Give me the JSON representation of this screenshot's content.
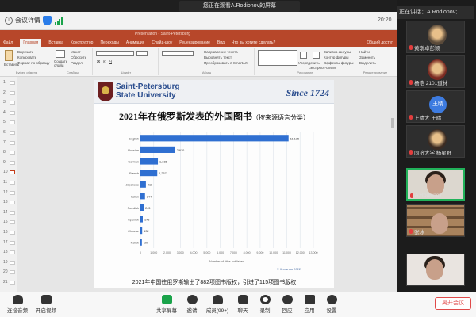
{
  "share_notice": "您正在观看A.Rodionov的屏幕",
  "meeting_top": {
    "info_label": "会议详情",
    "clock": "20:20"
  },
  "ppt": {
    "doc_title": "Presentation - Saint-Petersburg",
    "tabs": [
      "Файл",
      "Главная",
      "Вставка",
      "Конструктор",
      "Переходы",
      "Анимация",
      "Слайд-шоу",
      "Рецензирование",
      "Вид",
      "Что вы хотите сделать?"
    ],
    "share": "Общий доступ",
    "ribbon": {
      "paste": "Вставить",
      "cut": "Вырезать",
      "copy": "Копировать",
      "format": "Формат по образцу",
      "clipboard_group": "Буфер обмена",
      "new_slide": "Создать слайд",
      "layout": "Макет",
      "reset": "Сбросить",
      "section": "Раздел",
      "slides_group": "Слайды",
      "font_group": "Шрифт",
      "paragraph_group": "Абзац",
      "text_direction": "Направление текста",
      "align_text": "Выровнять текст",
      "convert_smartart": "Преобразовать в SmartArt",
      "drawing_group": "Рисование",
      "arrange": "Упорядочить",
      "quick_styles": "Экспресс-стили",
      "shape_fill": "Заливка фигуры",
      "shape_outline": "Контур фигуры",
      "shape_effects": "Эффекты фигуры",
      "find": "Найти",
      "replace": "Заменить",
      "select": "Выделить",
      "editing_group": "Редактирование"
    }
  },
  "slide": {
    "uni_line1": "Saint-Petersburg",
    "uni_line2": "State University",
    "since": "Since 1724",
    "title": "2021年在俄罗斯发表的外国图书",
    "title_sub": "（按来源语言分类）",
    "caption": "2021年中国往俄罗斯输出了882项图书版权，引进了115项图书版权",
    "footer": "© Книжная 2022"
  },
  "chart_data": {
    "type": "bar",
    "orientation": "horizontal",
    "categories": [
      "English",
      "Russian",
      "German",
      "French",
      "Japanese",
      "Italian",
      "Swedish",
      "Spanish",
      "Chinese",
      "Polish"
    ],
    "values": [
      11135,
      2610,
      1315,
      1267,
      411,
      344,
      243,
      178,
      132,
      109
    ],
    "value_labels": [
      "11,135",
      "2,610",
      "1,315",
      "1,267",
      "411",
      "344",
      "243",
      "178",
      "132",
      "109"
    ],
    "xlabel": "Number of titles published",
    "xlim": [
      0,
      13000
    ],
    "xticks": [
      "0",
      "1,000",
      "2,000",
      "3,000",
      "4,000",
      "5,000",
      "6,000",
      "7,000",
      "8,000",
      "9,000",
      "10,000",
      "11,000",
      "12,000",
      "13,000"
    ],
    "bar_color": "#2f6fd1",
    "grid": true
  },
  "thumbs": [
    1,
    2,
    3,
    4,
    5,
    6,
    7,
    8,
    9,
    10,
    11,
    12,
    13,
    14,
    15,
    16,
    17,
    18,
    19,
    20,
    21
  ],
  "video_panel": {
    "speaking_label": "正在讲话：",
    "speaking_name": "A.Rodionov;",
    "tiles": [
      {
        "name": "黄斯卓彭颖",
        "kind": "photo"
      },
      {
        "name": "杨浩 2101道林",
        "kind": "photo"
      },
      {
        "name": "上晴大 王晴",
        "kind": "avatar",
        "avatar_text": "王晴"
      },
      {
        "name": "同济大学 杨星野",
        "kind": "photo"
      },
      {
        "name": "A.Rodionov",
        "kind": "face",
        "active": true
      },
      {
        "name": "张冰",
        "kind": "shelf"
      },
      {
        "name": "",
        "kind": "face2"
      }
    ]
  },
  "toolbar": {
    "mute": "连接音频",
    "video": "开启视频",
    "share": "共享屏幕",
    "invite": "邀请",
    "members": "成员(99+)",
    "chat": "聊天",
    "record": "录制",
    "reactions": "回应",
    "apps": "应用",
    "settings": "设置",
    "leave": "离开会议"
  },
  "colors": {
    "ppt_accent": "#b7472a",
    "leave_red": "#e04a4a",
    "bar_blue": "#2f6fd1"
  }
}
